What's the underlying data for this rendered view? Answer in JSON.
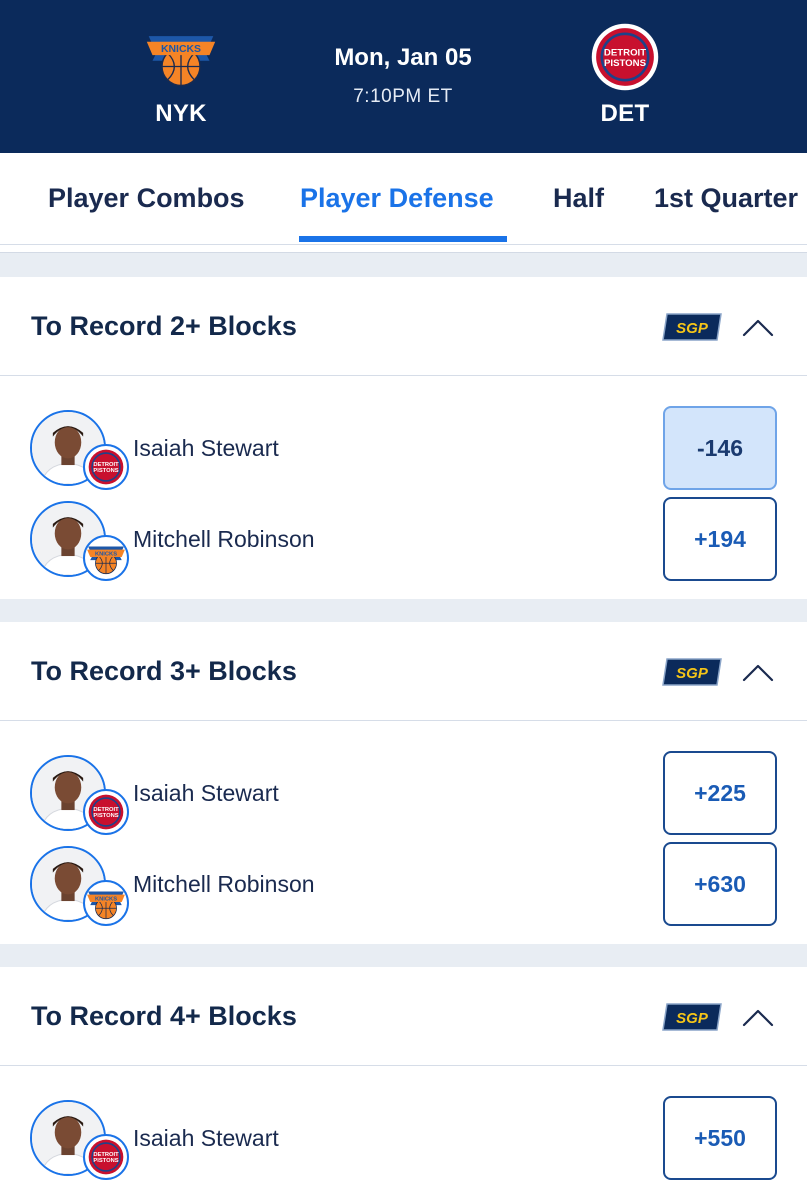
{
  "header": {
    "away": {
      "abbr": "NYK",
      "logo": "knicks-logo"
    },
    "home": {
      "abbr": "DET",
      "logo": "pistons-logo"
    },
    "date": "Mon, Jan 05",
    "time": "7:10PM ET",
    "colors": {
      "header_bg": "#0b2a5b",
      "accent": "#1a73e8"
    }
  },
  "tabs": [
    {
      "label": "Player Combos",
      "active": false
    },
    {
      "label": "Player Defense",
      "active": true
    },
    {
      "label": "Half",
      "active": false
    },
    {
      "label": "1st Quarter",
      "active": false
    }
  ],
  "markets": [
    {
      "title": "To Record 2+ Blocks",
      "sgp_label": "SGP",
      "selections": [
        {
          "player": "Isaiah Stewart",
          "team_logo": "pistons-logo",
          "odds": "-146",
          "selected": true
        },
        {
          "player": "Mitchell Robinson",
          "team_logo": "knicks-logo",
          "odds": "+194",
          "selected": false
        }
      ]
    },
    {
      "title": "To Record 3+ Blocks",
      "sgp_label": "SGP",
      "selections": [
        {
          "player": "Isaiah Stewart",
          "team_logo": "pistons-logo",
          "odds": "+225",
          "selected": false
        },
        {
          "player": "Mitchell Robinson",
          "team_logo": "knicks-logo",
          "odds": "+630",
          "selected": false
        }
      ]
    },
    {
      "title": "To Record 4+ Blocks",
      "sgp_label": "SGP",
      "selections": [
        {
          "player": "Isaiah Stewart",
          "team_logo": "pistons-logo",
          "odds": "+550",
          "selected": false
        }
      ]
    }
  ]
}
